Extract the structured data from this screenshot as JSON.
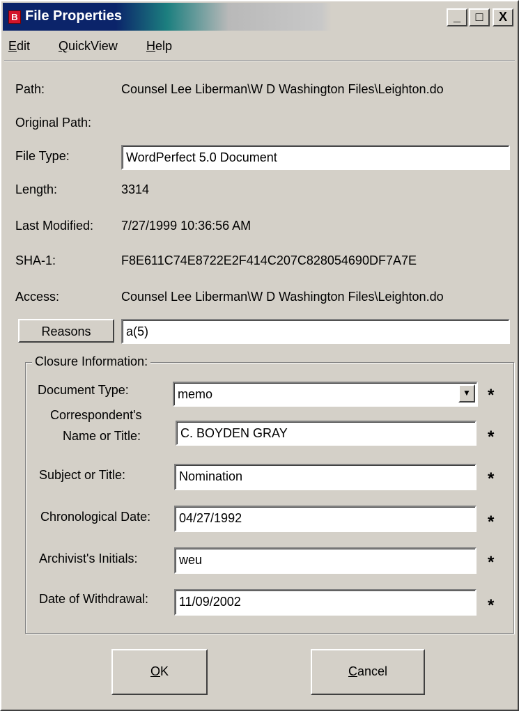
{
  "window": {
    "title": "File Properties",
    "app_icon_glyph": "B",
    "minimize_glyph": "_",
    "maximize_glyph": "□",
    "close_glyph": "X"
  },
  "menu": {
    "items": [
      {
        "label": "Edit",
        "mnemonic": "E",
        "rest": "dit"
      },
      {
        "label": "QuickView",
        "mnemonic": "Q",
        "rest": "uickView"
      },
      {
        "label": "Help",
        "mnemonic": "H",
        "rest": "elp"
      }
    ]
  },
  "properties": {
    "path_label": "Path:",
    "path_value": "Counsel Lee Liberman\\W D Washington Files\\Leighton.do",
    "original_path_label": "Original Path:",
    "original_path_value": "",
    "file_type_label": "File Type:",
    "file_type_value": "WordPerfect 5.0 Document",
    "length_label": "Length:",
    "length_value": "3314",
    "last_modified_label": "Last Modified:",
    "last_modified_value": "7/27/1999 10:36:56 AM",
    "sha1_label": "SHA-1:",
    "sha1_value": "F8E611C74E8722E2F414C207C828054690DF7A7E",
    "access_label": "Access:",
    "access_value": "Counsel Lee Liberman\\W D Washington Files\\Leighton.do",
    "reasons_button": "Reasons",
    "reasons_value": "a(5)"
  },
  "closure": {
    "legend": "Closure Information:",
    "required_marker": "*",
    "document_type_label": "Document Type:",
    "document_type_value": "memo",
    "correspondent_label_line1": "Correspondent's",
    "correspondent_label_line2": "Name or Title:",
    "correspondent_value": "C. BOYDEN GRAY",
    "subject_label": "Subject or Title:",
    "subject_value": "Nomination",
    "chrono_date_label": "Chronological Date:",
    "chrono_date_value": "04/27/1992",
    "archivist_label": "Archivist's Initials:",
    "archivist_value": "weu",
    "withdrawal_label": "Date of Withdrawal:",
    "withdrawal_value": "11/09/2002"
  },
  "buttons": {
    "ok": {
      "label": "OK",
      "mnemonic": "O",
      "rest": "K"
    },
    "cancel": {
      "label": "Cancel",
      "mnemonic": "C",
      "rest": "ancel"
    }
  },
  "colors": {
    "titlebar_active": "#0b246a",
    "face": "#d4d0c8",
    "app_icon_red": "#d4142a"
  }
}
